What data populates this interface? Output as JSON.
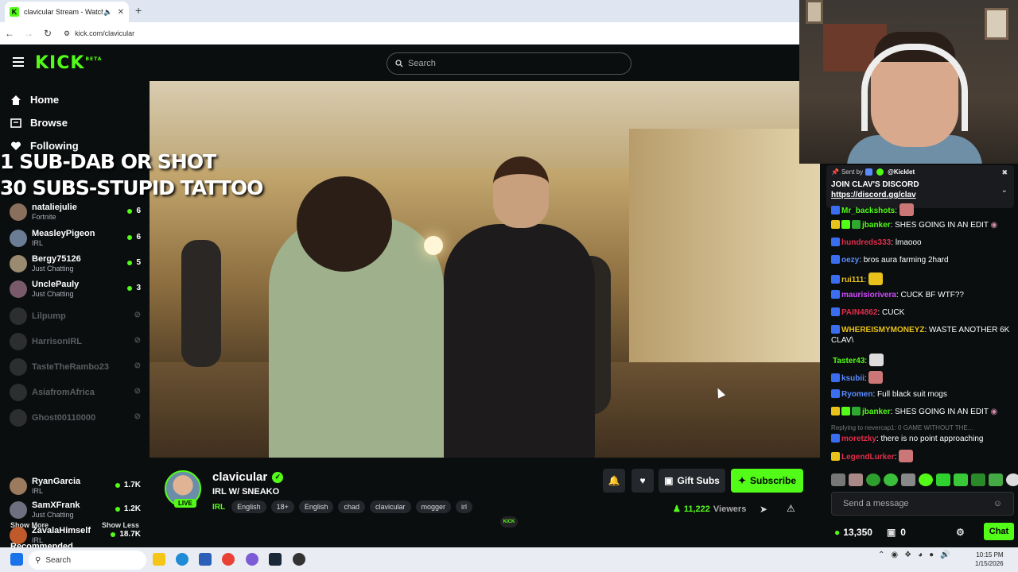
{
  "browser": {
    "tab_title": "clavicular Stream - Watch Li",
    "url": "kick.com/clavicular",
    "new_tab": "+"
  },
  "header": {
    "logo": "KICK",
    "logo_badge": "BETA",
    "search_placeholder": "Search"
  },
  "sidebar": {
    "nav": [
      "Home",
      "Browse",
      "Following"
    ],
    "overlay_lines": [
      "1 SUB-DAB OR SHOT",
      "30 SUBS-STUPID TATTOO"
    ],
    "following": [
      {
        "name": "nataliejulie",
        "category": "Fortnite",
        "count": "6",
        "online": true,
        "color": "#8a6f5c"
      },
      {
        "name": "MeasleyPigeon",
        "category": "IRL",
        "count": "6",
        "online": true,
        "color": "#6a7d95"
      },
      {
        "name": "Bergy75126",
        "category": "Just Chatting",
        "count": "5",
        "online": true,
        "color": "#9a8a70"
      },
      {
        "name": "UnclePauly",
        "category": "Just Chatting",
        "count": "3",
        "online": true,
        "color": "#7a5a6a"
      },
      {
        "name": "Lilpump",
        "category": "",
        "count": "",
        "online": false,
        "color": "#444"
      },
      {
        "name": "HarrisonIRL",
        "category": "",
        "count": "",
        "online": false,
        "color": "#444"
      },
      {
        "name": "TasteTheRambo23",
        "category": "",
        "count": "",
        "online": false,
        "color": "#444"
      },
      {
        "name": "AsiafromAfrica",
        "category": "",
        "count": "",
        "online": false,
        "color": "#444"
      },
      {
        "name": "Ghost00110000",
        "category": "",
        "count": "",
        "online": false,
        "color": "#444"
      }
    ],
    "show_more": "Show More",
    "show_less": "Show Less",
    "recommended_title": "Recommended",
    "recommended": [
      {
        "name": "RyanGarcia",
        "category": "IRL",
        "count": "1.7K",
        "color": "#9c7a5e"
      },
      {
        "name": "SamXFrank",
        "category": "Just Chatting",
        "count": "1.2K",
        "color": "#6f6f80"
      },
      {
        "name": "ZavalaHimself",
        "category": "IRL",
        "count": "18.7K",
        "color": "#c05a2a"
      }
    ]
  },
  "chat": {
    "pinned": {
      "sent_by_label": "Sent by",
      "sender": "@Kicklet",
      "message": "JOIN CLAV'S DISCORD",
      "link": "https://discord.gg/clav"
    },
    "messages": [
      {
        "user": "Mr_backshots",
        "text": "",
        "color": "#53fc18",
        "emote": true
      },
      {
        "user": "jbanker",
        "text": "SHES GOING IN AN EDIT",
        "color": "#53fc18",
        "badges": true
      },
      {
        "user": "hundreds333",
        "text": "lmaooo",
        "color": "#e02d4a"
      },
      {
        "user": "oezy",
        "text": "bros aura farming 2hard",
        "color": "#5b8cff"
      },
      {
        "user": "rui111",
        "text": "",
        "color": "#e8c21a",
        "emote": true
      },
      {
        "user": "maurisiorivera",
        "text": "CUCK BF WTF??",
        "color": "#d04bff"
      },
      {
        "user": "PAIN4862",
        "text": "CUCK",
        "color": "#e02d4a"
      },
      {
        "user": "WHEREISMYMONEYZ",
        "text": "WASTE ANOTHER 6K CLAV\\",
        "color": "#e8c21a"
      },
      {
        "user": "Taster43",
        "text": "",
        "color": "#53fc18",
        "emote": true
      },
      {
        "user": "ksubii",
        "text": "",
        "color": "#5b8cff",
        "emote": true
      },
      {
        "user": "Ryomen",
        "text": "Full black suit mogs",
        "color": "#5b8cff"
      },
      {
        "user": "jbanker",
        "text": "SHES GOING IN AN EDIT",
        "color": "#53fc18",
        "badges": true
      },
      {
        "user": "moretzky",
        "text": "there is no point approaching",
        "color": "#e02d4a"
      },
      {
        "user": "LegendLurker",
        "text": "",
        "color": "#e02d4a",
        "emote": true
      }
    ],
    "reply_text": "Replying to nevercap1: 0 GAME WITHOUT THE...",
    "input_placeholder": "Send a message",
    "points": "13,350",
    "gift_count": "0",
    "chat_button": "Chat"
  },
  "stream": {
    "streamer": "clavicular",
    "live_badge": "LIVE",
    "title": "IRL W/ SNEAKO",
    "category": "IRL",
    "tags": [
      "English",
      "18+",
      "English",
      "chad",
      "clavicular",
      "mogger",
      "irl"
    ],
    "gift_subs": "Gift Subs",
    "subscribe": "Subscribe",
    "viewers_count": "11,222",
    "viewers_label": "Viewers"
  },
  "taskbar": {
    "search": "Search",
    "time": "10:15 PM",
    "date": "1/15/2026"
  }
}
